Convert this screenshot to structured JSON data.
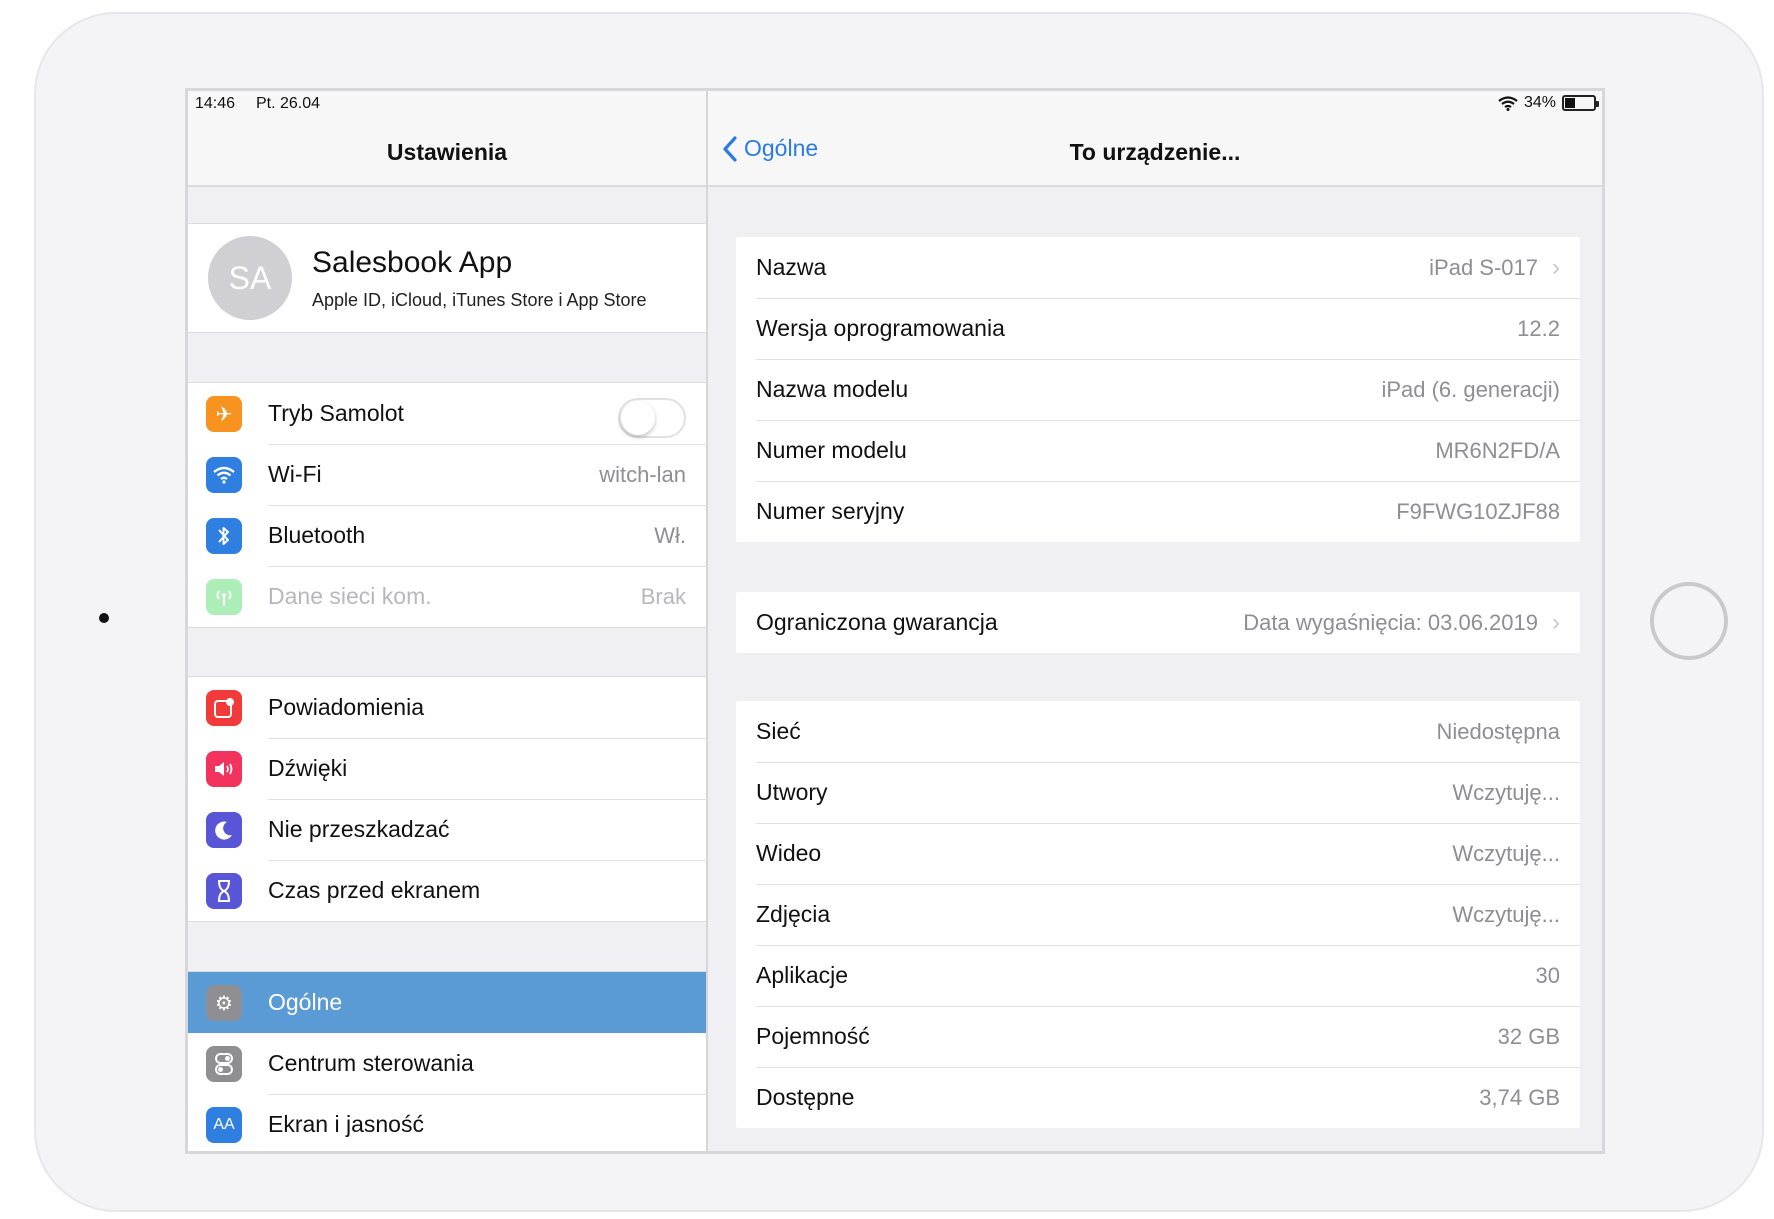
{
  "status_bar": {
    "time": "14:46",
    "date": "Pt. 26.04",
    "battery": "34%"
  },
  "master": {
    "title": "Ustawienia",
    "profile": {
      "initials": "SA",
      "name": "Salesbook App",
      "subtitle": "Apple ID, iCloud, iTunes Store i App Store"
    },
    "group_a": [
      {
        "label": "Tryb Samolot",
        "value": "",
        "icon": "airplane-icon",
        "color": "#f7931e"
      },
      {
        "label": "Wi-Fi",
        "value": "witch-lan",
        "icon": "wifi-icon",
        "color": "#2f7fe0"
      },
      {
        "label": "Bluetooth",
        "value": "Wł.",
        "icon": "bluetooth-icon",
        "color": "#2f7fe0"
      },
      {
        "label": "Dane sieci kom.",
        "value": "Brak",
        "icon": "cellular-icon",
        "color": "#4cd964"
      }
    ],
    "group_b": [
      {
        "label": "Powiadomienia",
        "icon": "notifications-icon",
        "color": "#f23a3a"
      },
      {
        "label": "Dźwięki",
        "icon": "sounds-icon",
        "color": "#f2335d"
      },
      {
        "label": "Nie przeszkadzać",
        "icon": "moon-icon",
        "color": "#5856d6"
      },
      {
        "label": "Czas przed ekranem",
        "icon": "hourglass-icon",
        "color": "#5856d6"
      }
    ],
    "group_c": [
      {
        "label": "Ogólne",
        "icon": "gear-icon",
        "color": "#8e8e93"
      },
      {
        "label": "Centrum sterowania",
        "icon": "control-center-icon",
        "color": "#8e8e93"
      },
      {
        "label": "Ekran i jasność",
        "icon": "display-icon",
        "color": "#2f7fe0"
      }
    ]
  },
  "detail": {
    "back_label": "Ogólne",
    "title": "To urządzenie...",
    "card1": [
      {
        "label": "Nazwa",
        "value": "iPad S-017"
      },
      {
        "label": "Wersja oprogramowania",
        "value": "12.2"
      },
      {
        "label": "Nazwa modelu",
        "value": "iPad (6. generacji)"
      },
      {
        "label": "Numer modelu",
        "value": "MR6N2FD/A"
      },
      {
        "label": "Numer seryjny",
        "value": "F9FWG10ZJF88"
      }
    ],
    "card2": [
      {
        "label": "Ograniczona gwarancja",
        "value": "Data wygaśnięcia: 03.06.2019"
      }
    ],
    "card3": [
      {
        "label": "Sieć",
        "value": "Niedostępna"
      },
      {
        "label": "Utwory",
        "value": "Wczytuję..."
      },
      {
        "label": "Wideo",
        "value": "Wczytuję..."
      },
      {
        "label": "Zdjęcia",
        "value": "Wczytuję..."
      },
      {
        "label": "Aplikacje",
        "value": "30"
      },
      {
        "label": "Pojemność",
        "value": "32 GB"
      },
      {
        "label": "Dostępne",
        "value": "3,74 GB"
      }
    ]
  }
}
